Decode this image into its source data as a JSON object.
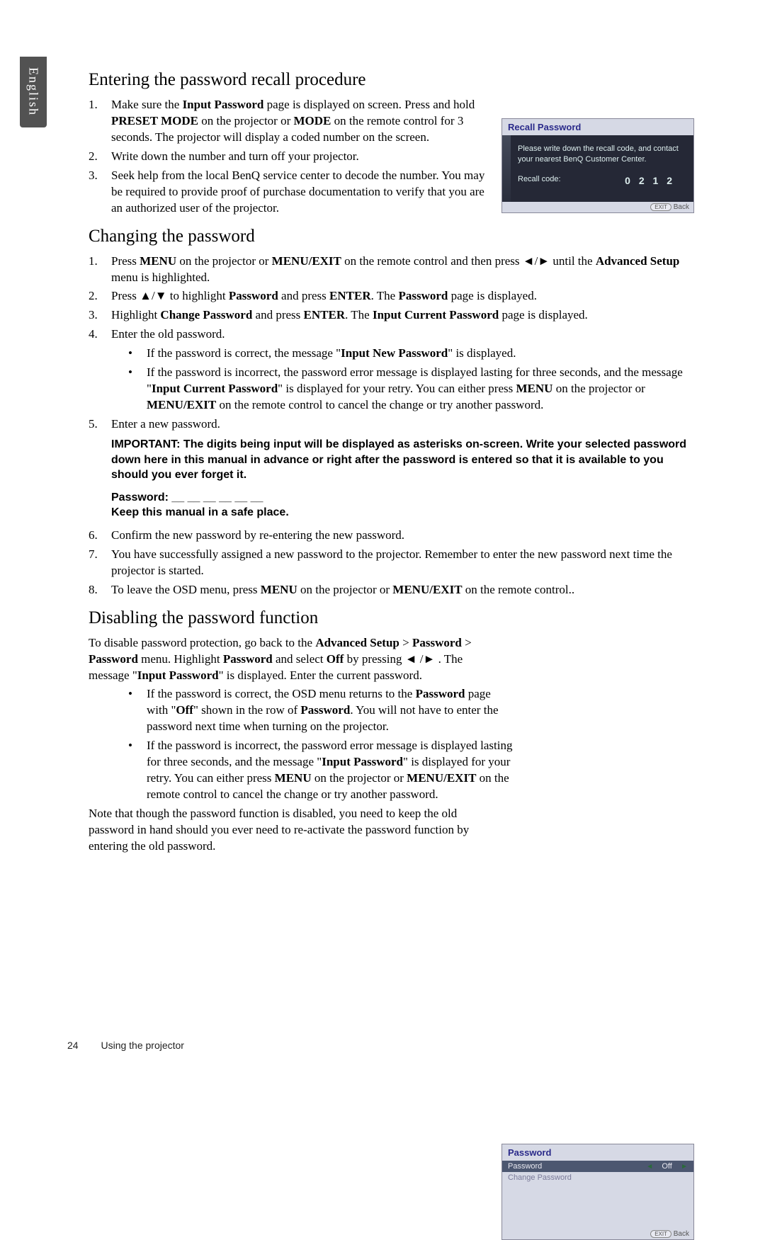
{
  "sideTab": "English",
  "section1": {
    "heading": "Entering the password recall procedure",
    "items": [
      {
        "num": "1.",
        "pre": "Make sure the ",
        "b1": "Input Password",
        "mid1": " page is displayed on screen. Press and hold ",
        "b2": "PRESET MODE",
        "mid2": " on the projector or ",
        "b3": "MODE",
        "post": " on the remote control for 3 seconds. The projector will display a coded number on the screen."
      },
      {
        "num": "2.",
        "text": "Write down the number and turn off your projector."
      },
      {
        "num": "3.",
        "text": "Seek help from the local BenQ service center to decode the number. You may be required to provide proof of purchase documentation to verify that you are an authorized user of the projector."
      }
    ]
  },
  "fig1": {
    "title": "Recall Password",
    "message": "Please write down the recall code, and contact your nearest BenQ Customer Center.",
    "label": "Recall code:",
    "code": "0 2 1 2",
    "exit": "EXIT",
    "back": "Back"
  },
  "section2": {
    "heading": "Changing the password",
    "li1": {
      "num": "1.",
      "pre": "Press ",
      "b1": "MENU",
      "mid1": " on the projector or ",
      "b2": "MENU/EXIT",
      "mid2": " on the remote control and then press ◄/► until the ",
      "b3": "Advanced Setup",
      "post": " menu is highlighted."
    },
    "li2": {
      "num": "2.",
      "pre": "Press ▲/▼ to highlight ",
      "b1": "Password",
      "mid1": " and press ",
      "b2": "ENTER",
      "mid2": ". The ",
      "b3": "Password",
      "post": " page is displayed."
    },
    "li3": {
      "num": "3.",
      "pre": "Highlight ",
      "b1": "Change Password",
      "mid1": " and press ",
      "b2": "ENTER",
      "mid2": ". The ",
      "b3": "Input Current Password",
      "post": " page is displayed."
    },
    "li4": {
      "num": "4.",
      "text": "Enter the old password."
    },
    "sub1": {
      "pre": "If the password is correct, the message \"",
      "b1": "Input New Password",
      "post": "\" is displayed."
    },
    "sub2": {
      "pre": "If the password is incorrect, the password error message is displayed lasting for three seconds, and the message \"",
      "b1": "Input Current Password",
      "mid1": "\" is displayed for your retry. You can either press ",
      "b2": "MENU",
      "mid2": " on the projector or ",
      "b3": "MENU/EXIT",
      "post": " on the remote control to cancel the change or try another password."
    },
    "li5": {
      "num": "5.",
      "text": "Enter a new password."
    },
    "important": "IMPORTANT: The digits being input will be displayed as asterisks on-screen. Write your selected password down here in this manual in advance or right after the password is entered so that it is available to you should you ever forget it.",
    "pwLine": "Password: __ __ __ __ __ __",
    "keep": "Keep this manual in a safe place.",
    "li6": {
      "num": "6.",
      "text": "Confirm the new password by re-entering the new password."
    },
    "li7": {
      "num": "7.",
      "text": "You have successfully assigned a new password to the projector. Remember to enter the new password next time the projector is started."
    },
    "li8": {
      "num": "8.",
      "pre": "To leave the OSD menu, press ",
      "b1": "MENU",
      "mid1": " on the projector or ",
      "b2": "MENU/EXIT",
      "post": " on the remote control.."
    }
  },
  "section3": {
    "heading": "Disabling the password function",
    "intro": {
      "pre": "To disable password protection, go back to the ",
      "b1": "Advanced Setup",
      "mid1": " > ",
      "b2": "Password",
      "mid2": " > ",
      "b3": "Password",
      "mid3": " menu. Highlight ",
      "b4": "Password",
      "mid4": " and select ",
      "b5": "Off",
      "mid5": " by pressing ◄ /► . The message \"",
      "b6": "Input Password",
      "post": "\" is displayed. Enter the current password."
    },
    "sub1": {
      "pre": "If the password is correct, the OSD menu returns to the ",
      "b1": "Password",
      "mid1": " page with \"",
      "b2": "Off",
      "mid2": "\" shown in the row of ",
      "b3": "Password",
      "post": ". You will not have to enter the password next time when turning on the projector."
    },
    "sub2": {
      "pre": "If the password is incorrect, the password error message is displayed lasting for three seconds, and the message \"",
      "b1": "Input Password",
      "mid1": "\" is displayed for your retry. You can either press ",
      "b2": "MENU",
      "mid2": " on the projector or ",
      "b3": "MENU/EXIT",
      "post": " on the remote control to cancel the change or try another password."
    },
    "note": "Note that though the password function is disabled, you need to keep the old password in hand should you ever need to re-activate the password function by entering the old password."
  },
  "fig2": {
    "title": "Password",
    "row1": {
      "label": "Password",
      "value": "Off"
    },
    "row2": {
      "label": "Change Password"
    },
    "exit": "EXIT",
    "back": "Back"
  },
  "footer": {
    "page": "24",
    "chapter": "Using the projector"
  }
}
